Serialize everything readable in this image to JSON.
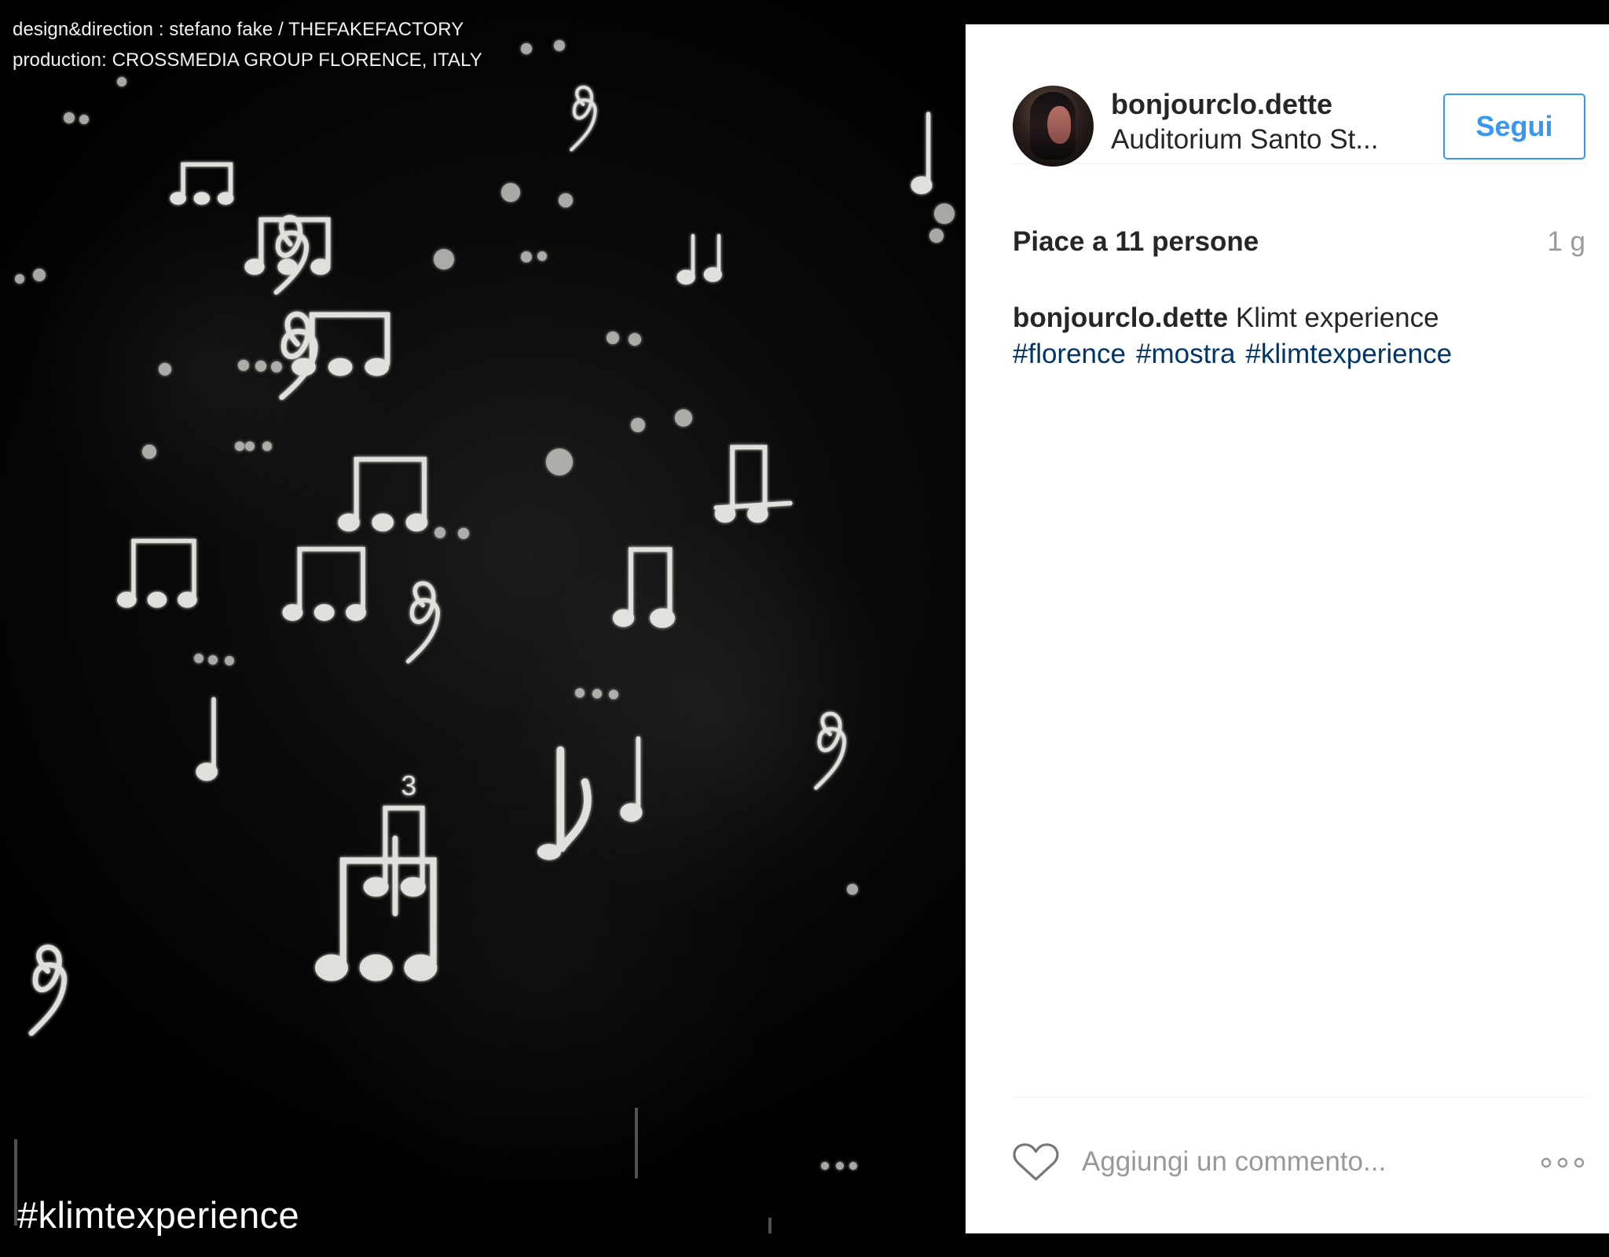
{
  "credits": {
    "line1": "design&direction : stefano fake / THEFAKEFACTORY",
    "line2": "production: CROSSMEDIA GROUP FLORENCE, ITALY"
  },
  "overlay": {
    "hashtag": "#klimtexperience"
  },
  "post": {
    "username": "bonjourclo.dette",
    "location": "Auditorium Santo St...",
    "follow_label": "Segui",
    "likes": "Piace a 11 persone",
    "age": "1 g",
    "caption_text": "Klimt experience",
    "tags": [
      "#florence",
      "#mostra",
      "#klimtexperience"
    ],
    "comment_placeholder": "Aggiungi un commento..."
  },
  "icons": {
    "avatar": "user-avatar",
    "like": "heart-icon",
    "more": "more-icon"
  }
}
